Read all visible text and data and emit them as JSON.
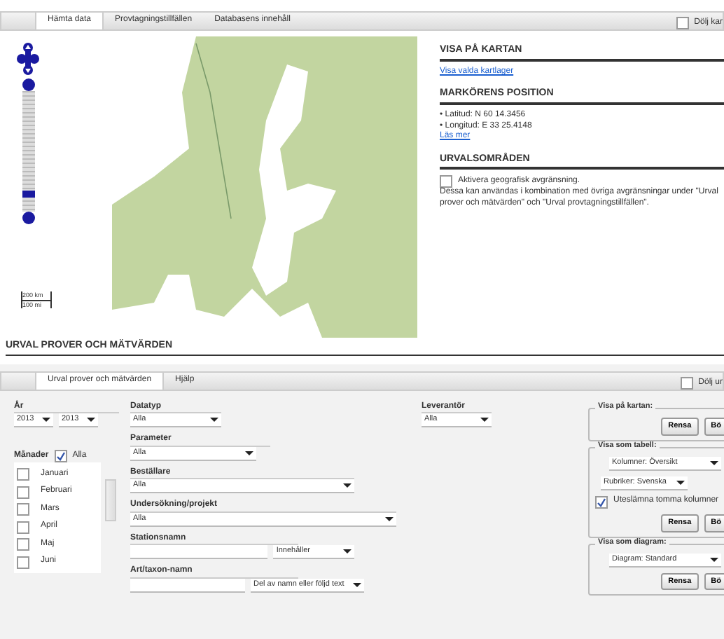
{
  "top_tabs": [
    {
      "label": "Hämta data",
      "selected": true
    },
    {
      "label": "Provtagningstillfällen",
      "selected": false
    },
    {
      "label": "Databasens innehåll",
      "selected": false
    }
  ],
  "hide_map": {
    "label": "Dölj kar",
    "checked": false
  },
  "map": {
    "zoom_slider": {
      "level": 0.12
    },
    "scale": [
      "200 km",
      "100 mi"
    ]
  },
  "info_panel": {
    "sections": [
      {
        "title": "VISA PÅ KARTAN",
        "lines": [
          {
            "kind": "link",
            "text": "Visa valda kartlager"
          }
        ]
      },
      {
        "title": "MARKÖRENS POSITION",
        "lines": [
          {
            "kind": "text",
            "text": "• Latitud: N 60 14.3456"
          },
          {
            "kind": "text",
            "text": "• Longitud: E 33 25.4148"
          },
          {
            "kind": "link",
            "text": "Läs mer"
          }
        ]
      },
      {
        "title": "URVALSOMRÅDEN",
        "lines": [
          {
            "kind": "checkbox",
            "text": "Aktivera geografisk avgränsning.",
            "checked": false
          },
          {
            "kind": "text",
            "text": "Dessa kan användas i kombination med övriga avgränsningar under \"Urval prover och mätvärden\" och \"Urval provtagningstillfällen\"."
          }
        ]
      }
    ]
  },
  "section_title": "URVAL PROVER OCH MÄTVÄRDEN",
  "form_tabs": [
    {
      "label": "Urval prover och mätvärden",
      "selected": true
    },
    {
      "label": "Hjälp",
      "selected": false
    }
  ],
  "hide_form": {
    "label": "Dölj ur",
    "checked": false
  },
  "form": {
    "year": {
      "label": "År",
      "from": "2013",
      "to": "2013"
    },
    "months": {
      "label": "Månader",
      "all_label": "Alla",
      "all_checked": true,
      "items": [
        {
          "label": "Januari",
          "checked": false
        },
        {
          "label": "Februari",
          "checked": false
        },
        {
          "label": "Mars",
          "checked": false
        },
        {
          "label": "April",
          "checked": false
        },
        {
          "label": "Maj",
          "checked": false
        },
        {
          "label": "Juni",
          "checked": false
        }
      ]
    },
    "datatyp": {
      "label": "Datatyp",
      "value": "Alla"
    },
    "leverantor": {
      "label": "Leverantör",
      "value": "Alla"
    },
    "parameter": {
      "label": "Parameter",
      "value": "Alla"
    },
    "bestallare": {
      "label": "Beställare",
      "value": "Alla"
    },
    "undersokning": {
      "label": "Undersökning/projekt",
      "value": "Alla"
    },
    "stationsnamn": {
      "label": "Stationsnamn",
      "mode": "Innehåller"
    },
    "taxon": {
      "label": "Art/taxon-namn",
      "mode": "Del av namn eller följd text"
    }
  },
  "outputs": [
    {
      "legend": "Visa på kartan:",
      "buttons": [
        "Rensa",
        "Bö"
      ]
    },
    {
      "legend": "Visa som tabell:",
      "selects": [
        {
          "text": "Kolumner: Översikt"
        },
        {
          "text": "Rubriker: Svenska"
        }
      ],
      "checkbox": {
        "label": "Uteslämna tomma kolumner",
        "checked": true
      },
      "buttons": [
        "Rensa",
        "Bö"
      ]
    },
    {
      "legend": "Visa som diagram:",
      "selects": [
        {
          "text": "Diagram: Standard"
        }
      ],
      "buttons": [
        "Rensa",
        "Bö"
      ]
    }
  ]
}
